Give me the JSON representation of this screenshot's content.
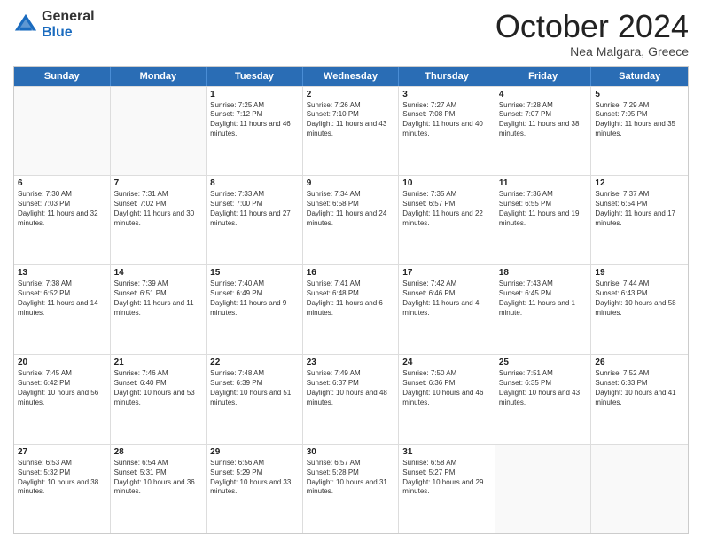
{
  "header": {
    "logo_general": "General",
    "logo_blue": "Blue",
    "month_title": "October 2024",
    "location": "Nea Malgara, Greece"
  },
  "weekdays": [
    "Sunday",
    "Monday",
    "Tuesday",
    "Wednesday",
    "Thursday",
    "Friday",
    "Saturday"
  ],
  "rows": [
    [
      {
        "day": "",
        "sunrise": "",
        "sunset": "",
        "daylight": ""
      },
      {
        "day": "",
        "sunrise": "",
        "sunset": "",
        "daylight": ""
      },
      {
        "day": "1",
        "sunrise": "Sunrise: 7:25 AM",
        "sunset": "Sunset: 7:12 PM",
        "daylight": "Daylight: 11 hours and 46 minutes."
      },
      {
        "day": "2",
        "sunrise": "Sunrise: 7:26 AM",
        "sunset": "Sunset: 7:10 PM",
        "daylight": "Daylight: 11 hours and 43 minutes."
      },
      {
        "day": "3",
        "sunrise": "Sunrise: 7:27 AM",
        "sunset": "Sunset: 7:08 PM",
        "daylight": "Daylight: 11 hours and 40 minutes."
      },
      {
        "day": "4",
        "sunrise": "Sunrise: 7:28 AM",
        "sunset": "Sunset: 7:07 PM",
        "daylight": "Daylight: 11 hours and 38 minutes."
      },
      {
        "day": "5",
        "sunrise": "Sunrise: 7:29 AM",
        "sunset": "Sunset: 7:05 PM",
        "daylight": "Daylight: 11 hours and 35 minutes."
      }
    ],
    [
      {
        "day": "6",
        "sunrise": "Sunrise: 7:30 AM",
        "sunset": "Sunset: 7:03 PM",
        "daylight": "Daylight: 11 hours and 32 minutes."
      },
      {
        "day": "7",
        "sunrise": "Sunrise: 7:31 AM",
        "sunset": "Sunset: 7:02 PM",
        "daylight": "Daylight: 11 hours and 30 minutes."
      },
      {
        "day": "8",
        "sunrise": "Sunrise: 7:33 AM",
        "sunset": "Sunset: 7:00 PM",
        "daylight": "Daylight: 11 hours and 27 minutes."
      },
      {
        "day": "9",
        "sunrise": "Sunrise: 7:34 AM",
        "sunset": "Sunset: 6:58 PM",
        "daylight": "Daylight: 11 hours and 24 minutes."
      },
      {
        "day": "10",
        "sunrise": "Sunrise: 7:35 AM",
        "sunset": "Sunset: 6:57 PM",
        "daylight": "Daylight: 11 hours and 22 minutes."
      },
      {
        "day": "11",
        "sunrise": "Sunrise: 7:36 AM",
        "sunset": "Sunset: 6:55 PM",
        "daylight": "Daylight: 11 hours and 19 minutes."
      },
      {
        "day": "12",
        "sunrise": "Sunrise: 7:37 AM",
        "sunset": "Sunset: 6:54 PM",
        "daylight": "Daylight: 11 hours and 17 minutes."
      }
    ],
    [
      {
        "day": "13",
        "sunrise": "Sunrise: 7:38 AM",
        "sunset": "Sunset: 6:52 PM",
        "daylight": "Daylight: 11 hours and 14 minutes."
      },
      {
        "day": "14",
        "sunrise": "Sunrise: 7:39 AM",
        "sunset": "Sunset: 6:51 PM",
        "daylight": "Daylight: 11 hours and 11 minutes."
      },
      {
        "day": "15",
        "sunrise": "Sunrise: 7:40 AM",
        "sunset": "Sunset: 6:49 PM",
        "daylight": "Daylight: 11 hours and 9 minutes."
      },
      {
        "day": "16",
        "sunrise": "Sunrise: 7:41 AM",
        "sunset": "Sunset: 6:48 PM",
        "daylight": "Daylight: 11 hours and 6 minutes."
      },
      {
        "day": "17",
        "sunrise": "Sunrise: 7:42 AM",
        "sunset": "Sunset: 6:46 PM",
        "daylight": "Daylight: 11 hours and 4 minutes."
      },
      {
        "day": "18",
        "sunrise": "Sunrise: 7:43 AM",
        "sunset": "Sunset: 6:45 PM",
        "daylight": "Daylight: 11 hours and 1 minute."
      },
      {
        "day": "19",
        "sunrise": "Sunrise: 7:44 AM",
        "sunset": "Sunset: 6:43 PM",
        "daylight": "Daylight: 10 hours and 58 minutes."
      }
    ],
    [
      {
        "day": "20",
        "sunrise": "Sunrise: 7:45 AM",
        "sunset": "Sunset: 6:42 PM",
        "daylight": "Daylight: 10 hours and 56 minutes."
      },
      {
        "day": "21",
        "sunrise": "Sunrise: 7:46 AM",
        "sunset": "Sunset: 6:40 PM",
        "daylight": "Daylight: 10 hours and 53 minutes."
      },
      {
        "day": "22",
        "sunrise": "Sunrise: 7:48 AM",
        "sunset": "Sunset: 6:39 PM",
        "daylight": "Daylight: 10 hours and 51 minutes."
      },
      {
        "day": "23",
        "sunrise": "Sunrise: 7:49 AM",
        "sunset": "Sunset: 6:37 PM",
        "daylight": "Daylight: 10 hours and 48 minutes."
      },
      {
        "day": "24",
        "sunrise": "Sunrise: 7:50 AM",
        "sunset": "Sunset: 6:36 PM",
        "daylight": "Daylight: 10 hours and 46 minutes."
      },
      {
        "day": "25",
        "sunrise": "Sunrise: 7:51 AM",
        "sunset": "Sunset: 6:35 PM",
        "daylight": "Daylight: 10 hours and 43 minutes."
      },
      {
        "day": "26",
        "sunrise": "Sunrise: 7:52 AM",
        "sunset": "Sunset: 6:33 PM",
        "daylight": "Daylight: 10 hours and 41 minutes."
      }
    ],
    [
      {
        "day": "27",
        "sunrise": "Sunrise: 6:53 AM",
        "sunset": "Sunset: 5:32 PM",
        "daylight": "Daylight: 10 hours and 38 minutes."
      },
      {
        "day": "28",
        "sunrise": "Sunrise: 6:54 AM",
        "sunset": "Sunset: 5:31 PM",
        "daylight": "Daylight: 10 hours and 36 minutes."
      },
      {
        "day": "29",
        "sunrise": "Sunrise: 6:56 AM",
        "sunset": "Sunset: 5:29 PM",
        "daylight": "Daylight: 10 hours and 33 minutes."
      },
      {
        "day": "30",
        "sunrise": "Sunrise: 6:57 AM",
        "sunset": "Sunset: 5:28 PM",
        "daylight": "Daylight: 10 hours and 31 minutes."
      },
      {
        "day": "31",
        "sunrise": "Sunrise: 6:58 AM",
        "sunset": "Sunset: 5:27 PM",
        "daylight": "Daylight: 10 hours and 29 minutes."
      },
      {
        "day": "",
        "sunrise": "",
        "sunset": "",
        "daylight": ""
      },
      {
        "day": "",
        "sunrise": "",
        "sunset": "",
        "daylight": ""
      }
    ]
  ]
}
